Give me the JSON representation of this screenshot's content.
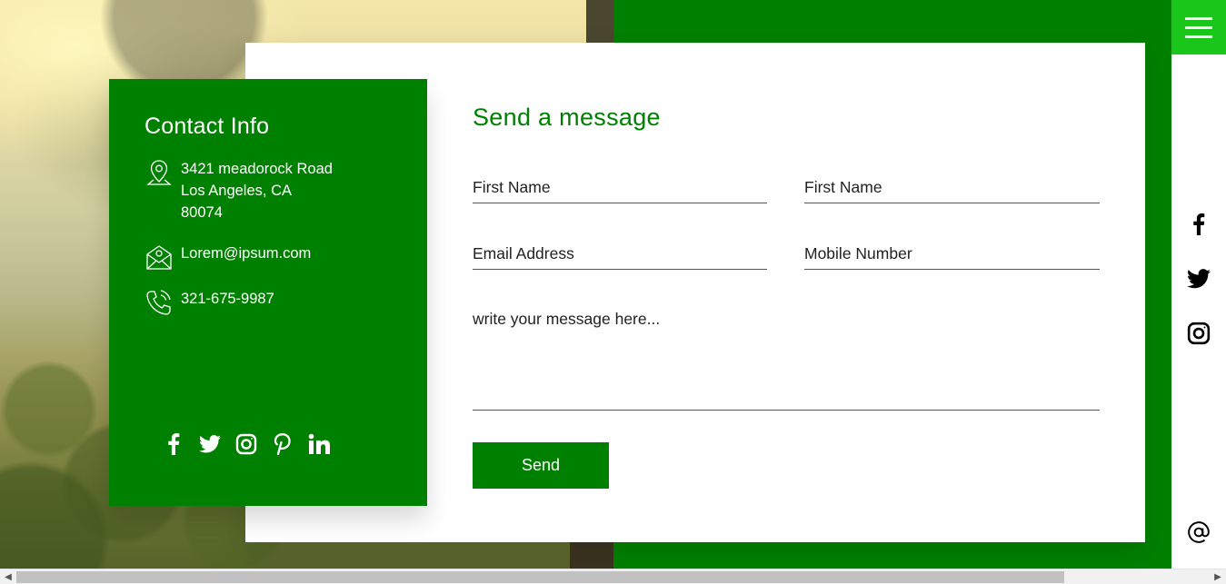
{
  "contact_info": {
    "title": "Contact Info",
    "address_line1": "3421 meadorock Road",
    "address_line2": "Los Angeles, CA",
    "address_line3": "80074",
    "email": "Lorem@ipsum.com",
    "phone": "321-675-9987",
    "social_icons": [
      "facebook-icon",
      "twitter-icon",
      "instagram-icon",
      "pinterest-icon",
      "linkedin-icon"
    ]
  },
  "form": {
    "title": "Send a message",
    "first_name_placeholder": "First Name",
    "last_name_placeholder": "First Name",
    "email_placeholder": "Email Address",
    "mobile_placeholder": "Mobile Number",
    "message_placeholder": "write your message here...",
    "send_label": "Send"
  },
  "side_bar": {
    "icons": [
      "menu-icon",
      "facebook-icon",
      "twitter-icon",
      "instagram-icon",
      "at-icon"
    ]
  },
  "colors": {
    "brand_green": "#008000",
    "menu_green": "#19c619",
    "white": "#ffffff"
  }
}
